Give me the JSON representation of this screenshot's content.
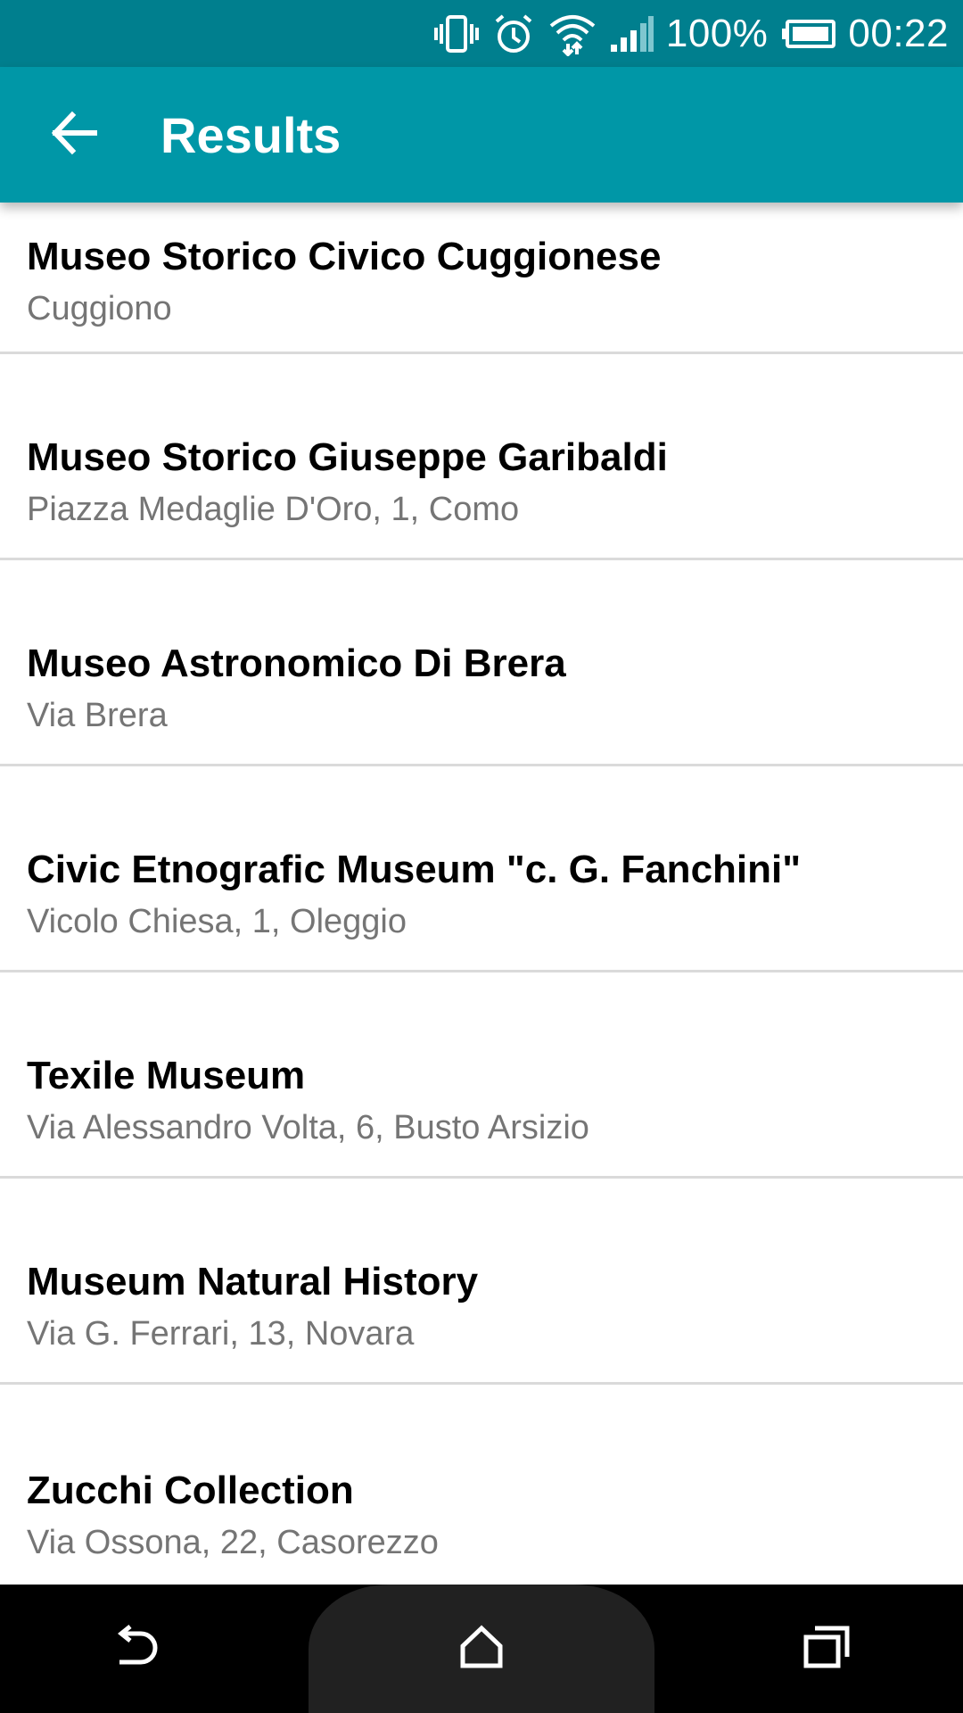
{
  "status_bar": {
    "battery_percent": "100%",
    "time": "00:22",
    "icons": [
      "vibrate-icon",
      "alarm-icon",
      "wifi-icon",
      "signal-icon",
      "battery-icon"
    ]
  },
  "app_bar": {
    "title": "Results",
    "back_icon": "arrow-back-icon",
    "background": "#0097a7"
  },
  "results": [
    {
      "title": "Museo Storico Civico Cuggionese",
      "subtitle": "Cuggiono"
    },
    {
      "title": "Museo Storico Giuseppe Garibaldi",
      "subtitle": "Piazza Medaglie D'Oro, 1, Como"
    },
    {
      "title": "Museo Astronomico Di Brera",
      "subtitle": "Via Brera"
    },
    {
      "title": "Civic Etnografic Museum \"c. G. Fanchini\"",
      "subtitle": "Vicolo Chiesa, 1, Oleggio"
    },
    {
      "title": "Texile Museum",
      "subtitle": "Via Alessandro Volta, 6, Busto Arsizio"
    },
    {
      "title": "Museum Natural History",
      "subtitle": "Via G. Ferrari, 13, Novara"
    },
    {
      "title": "Zucchi Collection",
      "subtitle": "Via Ossona, 22, Casorezzo"
    }
  ],
  "nav_bar": {
    "icons": [
      "back-nav-icon",
      "home-nav-icon",
      "recents-nav-icon"
    ]
  }
}
